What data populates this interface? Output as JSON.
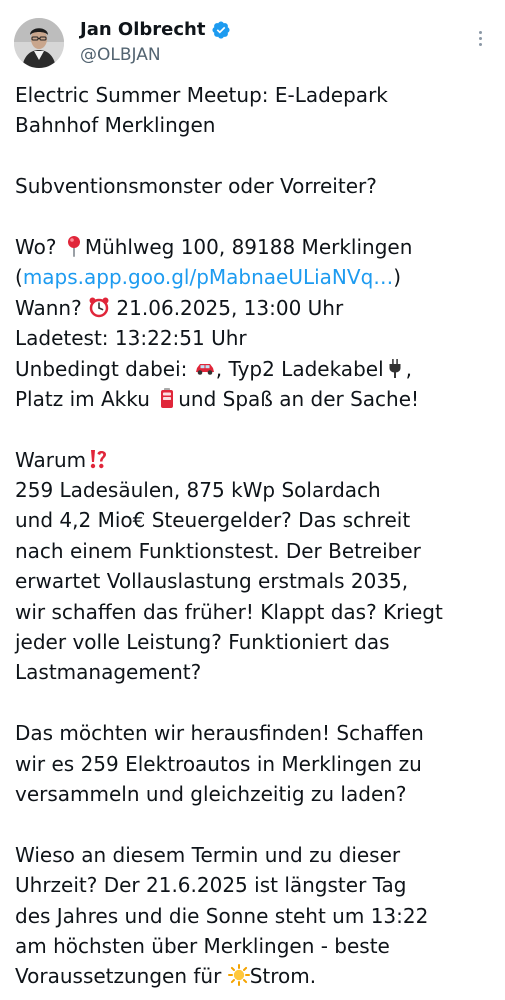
{
  "author": {
    "display_name": "Jan Olbrecht",
    "handle": "@OLBJAN",
    "verified_icon": "verified-badge-icon",
    "accent_color": "#1d9bf0"
  },
  "tweet": {
    "title_line1": "Electric Summer Meetup: E-Ladepark",
    "title_line2": "Bahnhof Merklingen",
    "question": "Subventionsmonster oder Vorreiter?",
    "where_label": "Wo? ",
    "where_icon": "round-pushpin-icon",
    "where_value": "Mühlweg 100, 89188 Merklingen",
    "link_open": "(",
    "link_text": "maps.app.goo.gl/pMabnaeULiaNVq…",
    "link_close": ")",
    "when_label": "Wann? ",
    "when_icon": "alarm-clock-icon",
    "when_value": " 21.06.2025, 13:00 Uhr",
    "ladetest": "Ladetest: 13:22:51 Uhr",
    "bring_label": "Unbedingt dabei: ",
    "bring_car_icon": "car-icon",
    "bring_cable": ", Typ2 Ladekabel",
    "bring_plug_icon": "electric-plug-icon",
    "bring_comma": ",",
    "bring_space": "Platz im Akku ",
    "bring_battery_icon": "battery-icon",
    "bring_fun": "und Spaß an der Sache!",
    "why_label": "Warum",
    "why_icon": "exclamation-question-mark-icon",
    "why_lines": [
      "259 Ladesäulen, 875 kWp Solardach",
      "und 4,2 Mio€ Steuergelder? Das schreit",
      "nach einem Funktionstest. Der Betreiber",
      "erwartet Vollauslastung erstmals 2035,",
      "wir schaffen das früher! Klappt das? Kriegt",
      "jeder volle Leistung? Funktioniert das",
      "Lastmanagement?"
    ],
    "goal_lines": [
      "Das möchten wir herausfinden! Schaffen",
      "wir es 259 Elektroautos in Merklingen zu",
      "versammeln und gleichzeitig zu laden?"
    ],
    "reason_lines": [
      "Wieso an diesem Termin und zu dieser",
      "Uhrzeit? Der 21.6.2025 ist längster Tag",
      "des Jahres und die Sonne steht um 13:22",
      "am höchsten über Merklingen - beste"
    ],
    "reason_last_prefix": "Voraussetzungen für ",
    "reason_sun_icon": "sun-icon",
    "reason_last_suffix": "Strom."
  }
}
